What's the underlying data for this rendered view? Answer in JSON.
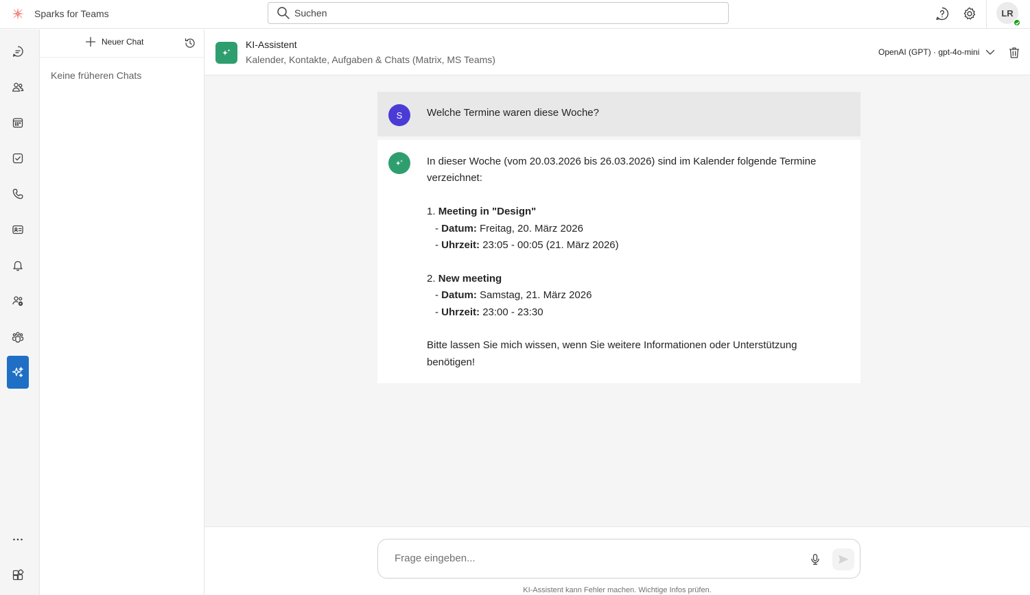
{
  "app": {
    "name": "Sparks for Teams"
  },
  "search": {
    "placeholder": "Suchen"
  },
  "user": {
    "initials": "LR",
    "status": "available"
  },
  "chat_list": {
    "new_chat_label": "Neuer Chat",
    "empty_text": "Keine früheren Chats"
  },
  "assistant": {
    "title": "KI-Assistent",
    "subtitle": "Kalender, Kontakte, Aufgaben & Chats (Matrix, MS Teams)",
    "model": "OpenAI (GPT) · gpt-4o-mini"
  },
  "conversation": {
    "user_message": {
      "avatar": "S",
      "text": "Welche Termine waren diese Woche?"
    },
    "bot_message": {
      "intro": "In dieser Woche (vom 20.03.2026 bis 26.03.2026) sind im Kalender folgende Termine verzeichnet:",
      "items": [
        {
          "number": "1.",
          "title": "Meeting in \"Design\"",
          "date_label": "Datum:",
          "date": "Freitag, 20. März 2026",
          "time_label": "Uhrzeit:",
          "time": "23:05 - 00:05 (21. März 2026)"
        },
        {
          "number": "2.",
          "title": "New meeting",
          "date_label": "Datum:",
          "date": "Samstag, 21. März 2026",
          "time_label": "Uhrzeit:",
          "time": "23:00 - 23:30"
        }
      ],
      "closing": "Bitte lassen Sie mich wissen, wenn Sie weitere Informationen oder Unterstützung benötigen!"
    }
  },
  "composer": {
    "placeholder": "Frage eingeben...",
    "disclaimer": "KI-Assistent kann Fehler machen. Wichtige Infos prüfen."
  },
  "colors": {
    "accent": "#1f6fc5",
    "assistant_green": "#2f9e6e",
    "user_avatar": "#4b3bd6",
    "presence": "#13a10e"
  },
  "rail_icons": [
    "chat-icon",
    "contacts-icon",
    "calendar-icon",
    "tasks-icon",
    "phone-icon",
    "contact-card-icon",
    "bell-icon",
    "people-settings-icon",
    "teams-icon",
    "sparkle-icon",
    "more-icon",
    "apps-icon"
  ]
}
